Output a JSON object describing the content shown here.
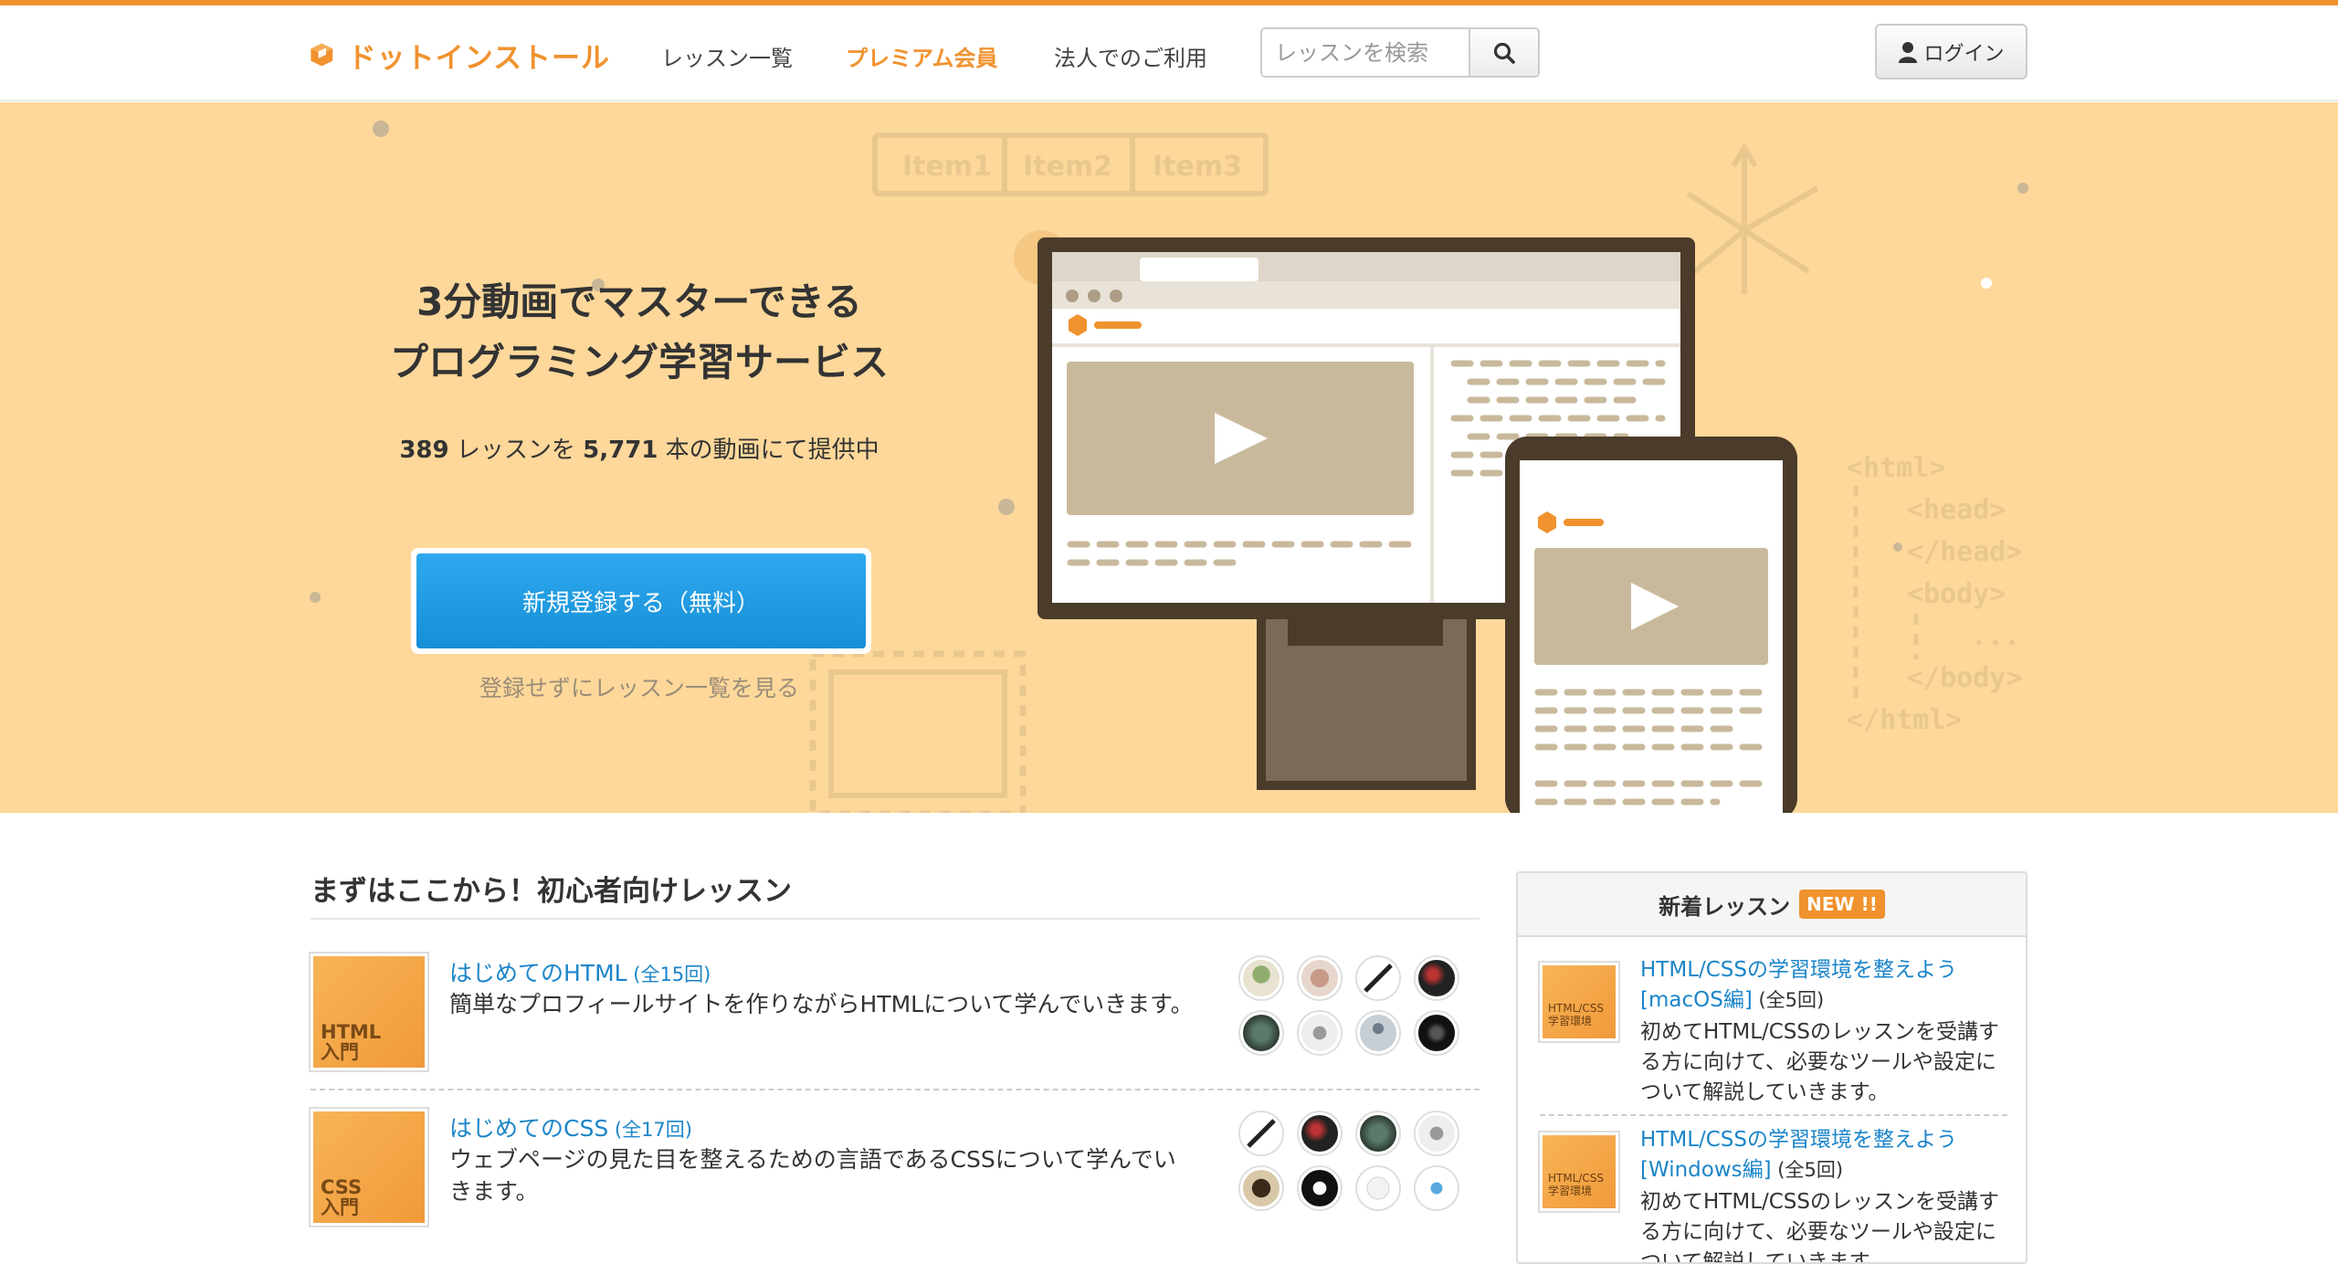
{
  "header": {
    "logo_text": "ドットインストール",
    "nav": [
      "レッスン一覧",
      "プレミアム会員",
      "法人でのご利用"
    ],
    "search_placeholder": "レッスンを検索",
    "login_label": "ログイン"
  },
  "hero": {
    "title_line1": "3分動画でマスターできる",
    "title_line2": "プログラミング学習サービス",
    "lesson_count": "389",
    "sub_part1": " レッスンを ",
    "video_count": "5,771",
    "sub_part2": " 本の動画にて提供中",
    "signup_label": "新規登録する（無料）",
    "browse_link": "登録せずにレッスン一覧を見る",
    "art_tabs": [
      "Item1",
      "Item2",
      "Item3"
    ],
    "art_code": [
      "<html>",
      "<head>",
      "</head>",
      "<body>",
      "...",
      "</body>",
      "</html>"
    ]
  },
  "beginner": {
    "heading": "まずはここから！初心者向けレッスン",
    "lessons": [
      {
        "thumb_label": "HTML\n入門",
        "title": "はじめてのHTML",
        "count": " (全15回)",
        "description": "簡単なプロフィールサイトを作りながらHTMLについて学んでいきます。"
      },
      {
        "thumb_label": "CSS\n入門",
        "title": "はじめてのCSS",
        "count": " (全17回)",
        "description": "ウェブページの見た目を整えるための言語であるCSSについて学んでいきます。"
      }
    ]
  },
  "sidebar": {
    "heading": "新着レッスン",
    "badge": "NEW !!",
    "items": [
      {
        "thumb_label": "HTML/CSS\n学習環境",
        "title": "HTML/CSSの学習環境を整えよう [macOS編]",
        "count": " (全5回)",
        "description": "初めてHTML/CSSのレッスンを受講する方に向けて、必要なツールや設定について解説していきます。"
      },
      {
        "thumb_label": "HTML/CSS\n学習環境",
        "title": "HTML/CSSの学習環境を整えよう [Windows編]",
        "count": " (全5回)",
        "description": "初めてHTML/CSSのレッスンを受講する方に向けて、必要なツールや設定について解説していきます。"
      }
    ]
  },
  "colors": {
    "accent": "#f0922e",
    "hero_bg": "#fdd89a",
    "link": "#1b85c9",
    "signup": "#1d98e0"
  }
}
